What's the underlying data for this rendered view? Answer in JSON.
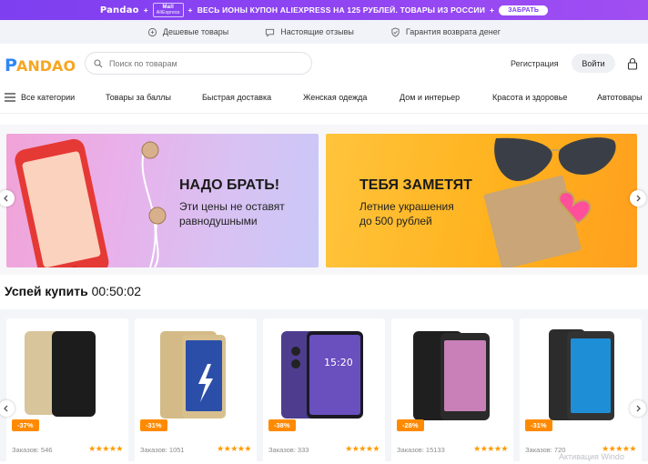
{
  "promo": {
    "brand": "Pandao",
    "plus1": "+",
    "ali_top": "Mall",
    "ali_bottom": "AliExpress",
    "plus2": "+",
    "text": "ВЕСЬ ИОНЫ КУПОН ALIEXPRESS НА 125 РУБЛЕЙ. ТОВАРЫ ИЗ РОССИИ",
    "plus3": "+",
    "cta": "ЗАБРАТЬ"
  },
  "usp": [
    {
      "label": "Дешевые товары",
      "icon": "tag-icon"
    },
    {
      "label": "Настоящие отзывы",
      "icon": "review-icon"
    },
    {
      "label": "Гарантия возврата денег",
      "icon": "shield-icon"
    }
  ],
  "header": {
    "brand": "PANDAO",
    "search_placeholder": "Поиск по товарам",
    "register": "Регистрация",
    "login": "Войти"
  },
  "nav": {
    "all_categories": "Все категории",
    "items": [
      "Товары за баллы",
      "Быстрая доставка",
      "Женская одежда",
      "Дом и интерьер",
      "Красота и здоровье",
      "Автотовары"
    ]
  },
  "banners": [
    {
      "title": "НАДО БРАТЬ!",
      "subtitle_1": "Эти цены не оставят",
      "subtitle_2": "равнодушными"
    },
    {
      "title": "ТЕБЯ ЗАМЕТЯТ",
      "subtitle_1": "Летние украшения",
      "subtitle_2": "до 500 рублей"
    }
  ],
  "deal": {
    "label": "Успей купить",
    "timer": "00:50:02"
  },
  "products": [
    {
      "discount": "-37%",
      "orders": "Заказов: 546",
      "stars": "★★★★★",
      "screen_color": "#1c1c1c"
    },
    {
      "discount": "-31%",
      "orders": "Заказов: 1051",
      "stars": "★★★★★",
      "screen_color": "#2b4ea8"
    },
    {
      "discount": "-38%",
      "orders": "Заказов: 333",
      "stars": "★★★★★",
      "screen_color": "#6a4fbf"
    },
    {
      "discount": "-28%",
      "orders": "Заказов: 15133",
      "stars": "★★★★★",
      "screen_color": "#c97fb7"
    },
    {
      "discount": "-31%",
      "orders": "Заказов: 720",
      "stars": "★★★★★",
      "screen_color": "#1e8fd6"
    }
  ],
  "watermark": "Активация Windo",
  "colors": {
    "promo": "#8a42f2",
    "accent": "#ff8a00",
    "banner_pink": "#f1a3d7",
    "banner_yellow": "#ffbb2e"
  }
}
